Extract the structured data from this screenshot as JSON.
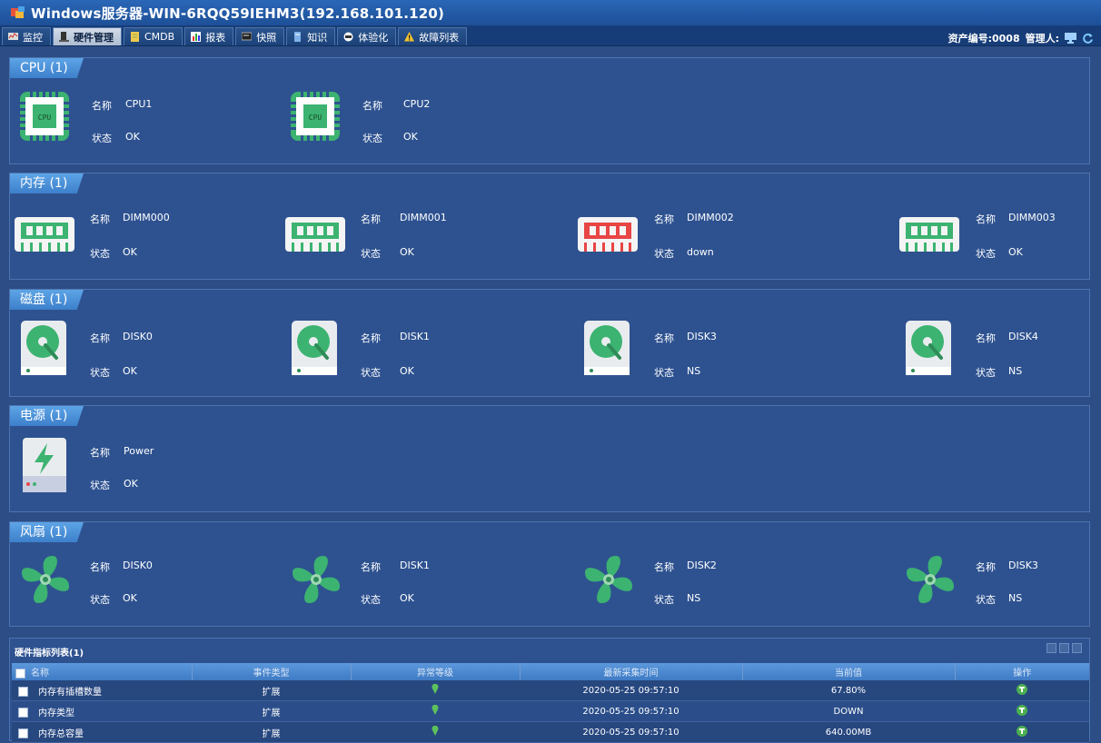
{
  "window": {
    "title": "Windows服务器-WIN-6RQQ59IEHM3(192.168.101.120)"
  },
  "tabs": [
    {
      "label": "监控",
      "icon": "monitor-icon",
      "active": false
    },
    {
      "label": "硬件管理",
      "icon": "hardware-icon",
      "active": true
    },
    {
      "label": "CMDB",
      "icon": "cmdb-icon",
      "active": false
    },
    {
      "label": "报表",
      "icon": "report-icon",
      "active": false
    },
    {
      "label": "快照",
      "icon": "snapshot-icon",
      "active": false
    },
    {
      "label": "知识",
      "icon": "knowledge-icon",
      "active": false
    },
    {
      "label": "体验化",
      "icon": "experience-icon",
      "active": false
    },
    {
      "label": "故障列表",
      "icon": "warning-icon",
      "active": false
    }
  ],
  "header": {
    "asset": "资产编号:0008",
    "admin": "管理人:"
  },
  "labels": {
    "name": "名称",
    "status": "状态"
  },
  "cpu": {
    "title": "CPU (1)",
    "items": [
      {
        "name": "CPU1",
        "status": "OK",
        "chip_text": "CPU"
      },
      {
        "name": "CPU2",
        "status": "OK",
        "chip_text": "CPU"
      }
    ]
  },
  "memory": {
    "title": "内存 (1)",
    "items": [
      {
        "name": "DIMM000",
        "status": "OK",
        "state": "ok"
      },
      {
        "name": "DIMM001",
        "status": "OK",
        "state": "ok"
      },
      {
        "name": "DIMM002",
        "status": "down",
        "state": "error"
      },
      {
        "name": "DIMM003",
        "status": "OK",
        "state": "ok"
      }
    ]
  },
  "disk": {
    "title": "磁盘 (1)",
    "items": [
      {
        "name": "DISK0",
        "status": "OK"
      },
      {
        "name": "DISK1",
        "status": "OK"
      },
      {
        "name": "DISK3",
        "status": "NS"
      },
      {
        "name": "DISK4",
        "status": "NS"
      }
    ]
  },
  "power": {
    "title": "电源 (1)",
    "items": [
      {
        "name": "Power",
        "status": "OK"
      }
    ]
  },
  "fan": {
    "title": "风扇 (1)",
    "items": [
      {
        "name": "DISK0",
        "status": "OK"
      },
      {
        "name": "DISK1",
        "status": "OK"
      },
      {
        "name": "DISK2",
        "status": "NS"
      },
      {
        "name": "DISK3",
        "status": "NS"
      }
    ]
  },
  "metrics": {
    "title": "硬件指标列表(1)",
    "columns": [
      "名称",
      "事件类型",
      "异常等级",
      "最新采集时间",
      "当前值",
      "操作"
    ],
    "rows": [
      {
        "name": "内存有插槽数量",
        "type": "扩展",
        "time": "2020-05-25 09:57:10",
        "value": "67.80%"
      },
      {
        "name": "内存类型",
        "type": "扩展",
        "time": "2020-05-25 09:57:10",
        "value": "DOWN"
      },
      {
        "name": "内存总容量",
        "type": "扩展",
        "time": "2020-05-25 09:57:10",
        "value": "640.00MB"
      }
    ]
  },
  "colors": {
    "ok": "#4caf50",
    "error": "#e84545",
    "accent": "#3d80cb"
  }
}
